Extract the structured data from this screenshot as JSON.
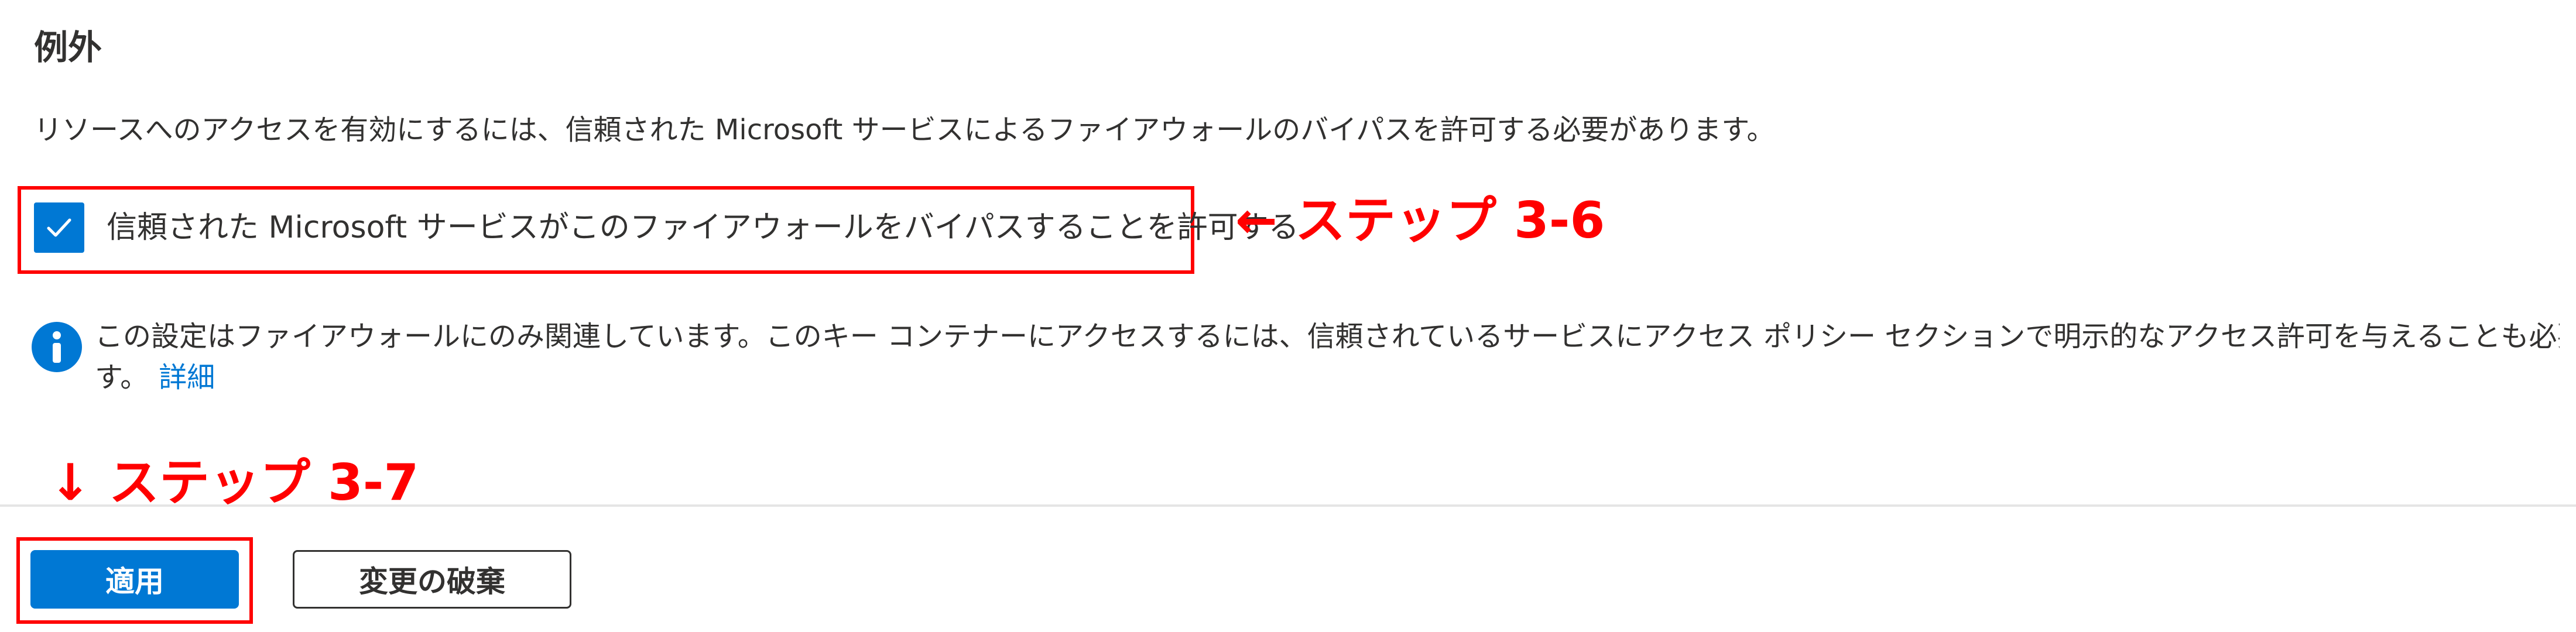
{
  "exceptions": {
    "title": "例外",
    "description": "リソースへのアクセスを有効にするには、信頼された Microsoft サービスによるファイアウォールのバイパスを許可する必要があります。",
    "trusted_services_checkbox": {
      "label": "信頼された Microsoft サービスがこのファイアウォールをバイパスすることを許可する",
      "checked": true,
      "icon": "checkmark-icon"
    },
    "info": {
      "icon": "info-icon",
      "text_line1": "この設定はファイアウォールにのみ関連しています。このキー コンテナーにアクセスするには、信頼されているサービスにアクセス ポリシー セクションで明示的なアクセス許可を与えることも必要で",
      "text_line2": "す。",
      "link_label": "詳細"
    }
  },
  "annotations": {
    "step_3_6": "← ステップ 3-6",
    "step_3_7": "↓ ステップ 3-7"
  },
  "footer": {
    "apply_label": "適用",
    "discard_label": "変更の破棄"
  },
  "colors": {
    "accent": "#0078d4",
    "annotation": "#ff0000",
    "text": "#323130"
  }
}
